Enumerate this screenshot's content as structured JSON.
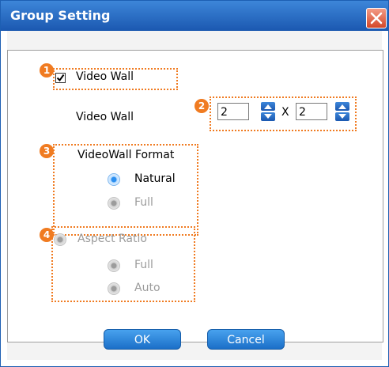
{
  "window": {
    "title": "Group Setting",
    "close_icon": "close-icon"
  },
  "video_wall_toggle": {
    "label": "Video Wall",
    "checked": true,
    "badge": "1"
  },
  "video_wall_size": {
    "label": "Video Wall",
    "columns": "2",
    "separator": "X",
    "rows": "2",
    "badge": "2"
  },
  "format": {
    "title": "VideoWall Format",
    "badge": "3",
    "options": [
      {
        "label": "Natural",
        "selected": true,
        "enabled": true
      },
      {
        "label": "Full",
        "selected": false,
        "enabled": false
      }
    ]
  },
  "aspect_ratio": {
    "title": "Aspect Ratio",
    "badge": "4",
    "enabled": false,
    "options": [
      {
        "label": "Full",
        "selected": false,
        "enabled": false
      },
      {
        "label": "Auto",
        "selected": false,
        "enabled": false
      }
    ]
  },
  "buttons": {
    "ok": "OK",
    "cancel": "Cancel"
  },
  "colors": {
    "title_bar": "#1b58b0",
    "callout": "#f07b21",
    "button": "#1b6fc8"
  }
}
